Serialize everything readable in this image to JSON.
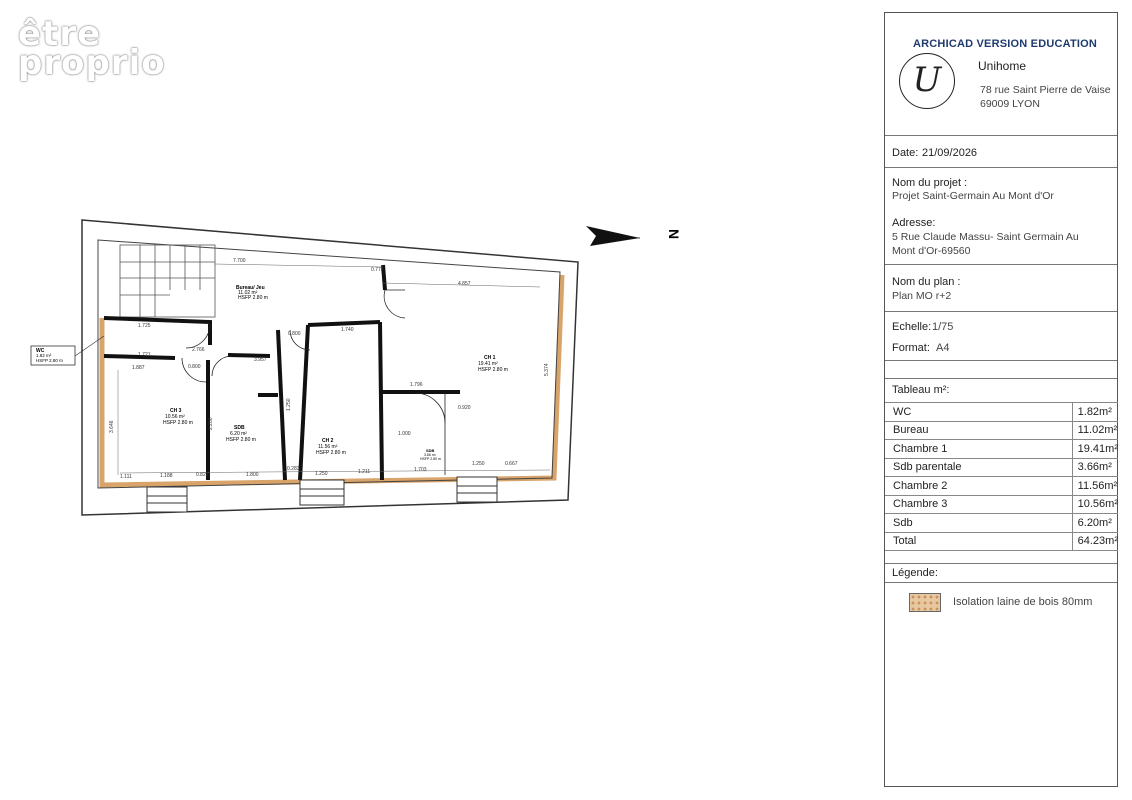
{
  "watermark": {
    "line1": "être",
    "line2": "proprio"
  },
  "north_label": "N",
  "plan": {
    "rooms": [
      {
        "id": "wc",
        "name": "WC",
        "area": "1.82 m²",
        "hsfp": "HSFP 2.80 m"
      },
      {
        "id": "bureau",
        "name": "Bureau/ Jeu",
        "area": "11.02 m²",
        "hsfp": "HSFP 2.80 m"
      },
      {
        "id": "ch1",
        "name": "CH 1",
        "area": "19.41 m²",
        "hsfp": "HSFP 2.80 m"
      },
      {
        "id": "ch3",
        "name": "CH 3",
        "area": "10.56 m²",
        "hsfp": "HSFP 2.80 m"
      },
      {
        "id": "sdb",
        "name": "SDB",
        "area": "6.20 m²",
        "hsfp": "HSFP 2.80 m"
      },
      {
        "id": "ch2",
        "name": "CH 2",
        "area": "11.56 m²",
        "hsfp": "HSFP 2.80 m"
      },
      {
        "id": "sdb2",
        "name": "SDB",
        "area": "3.66 m²",
        "hsfp": "HSFP 2.80 m"
      }
    ],
    "dimensions": [
      "7.700",
      "0.772",
      "4.857",
      "1.725",
      "1.721",
      "2.766",
      "0.800",
      "3.957",
      "1.740",
      "1.887",
      "0.800",
      "1.796",
      "1.000",
      "0.920",
      "1.111",
      "1.188",
      "0.822",
      "1.800",
      "0.283",
      "1.250",
      "1.211",
      "1.703",
      "1.250",
      "0.667",
      "3.646",
      "1.250",
      "2.200",
      "5.374"
    ]
  },
  "panel": {
    "title": "ARCHICAD VERSION EDUCATION",
    "logo_letter": "U",
    "company": "Unihome",
    "address_line1": "78 rue Saint Pierre de Vaise",
    "address_line2": "69009 LYON",
    "date_label": "Date:",
    "date_value": "21/09/2026",
    "project_label": "Nom du projet :",
    "project_value": "Projet Saint-Germain Au Mont d'Or",
    "address_label": "Adresse:",
    "address_value": "5 Rue Claude Massu- Saint Germain Au Mont d'Or-69560",
    "plan_label": "Nom du plan :",
    "plan_value": "Plan MO r+2",
    "scale_label": "Echelle:",
    "scale_value": "1/75",
    "format_label": "Format:",
    "format_value": "A4",
    "table_title": "Tableau m²:",
    "table_rows": [
      {
        "room": "WC",
        "area": "1.82m²"
      },
      {
        "room": "Bureau",
        "area": "11.02m²"
      },
      {
        "room": "Chambre 1",
        "area": "19.41m²"
      },
      {
        "room": "Sdb parentale",
        "area": "3.66m²"
      },
      {
        "room": "Chambre 2",
        "area": "11.56m²"
      },
      {
        "room": "Chambre 3",
        "area": "10.56m²"
      },
      {
        "room": "Sdb",
        "area": "6.20m²"
      }
    ],
    "total_label": "Total",
    "total_value": "64.23m²",
    "legend_label": "Légende:",
    "legend_item": "Isolation laine de bois 80mm"
  },
  "colors": {
    "insulation": "#d9a46a",
    "wall": "#111111",
    "outline": "#333333",
    "title_blue": "#1f3b6e"
  }
}
